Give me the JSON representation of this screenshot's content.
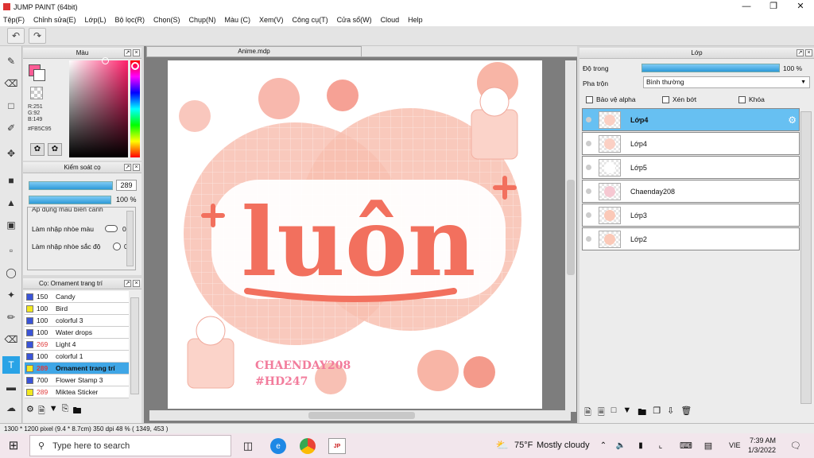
{
  "window": {
    "title": "JUMP PAINT (64bit)"
  },
  "menu": [
    "Tệp(F)",
    "Chỉnh sửa(E)",
    "Lớp(L)",
    "Bộ lọc(R)",
    "Chọn(S)",
    "Chụp(N)",
    "Màu (C)",
    "Xem(V)",
    "Công cụ(T)",
    "Cửa sổ(W)",
    "Cloud",
    "Help"
  ],
  "color_panel": {
    "title": "Màu",
    "main_color": "#FB5C95",
    "r": "R:251",
    "g": "G:92",
    "b": "B:149",
    "hex": "#FB5C95"
  },
  "brush_panel": {
    "title": "Kiểm soát cọ",
    "size": "289",
    "opacity": "100 %",
    "apply_label": "Áp dụng màu biên cảnh",
    "blur_color_label": "Làm nhập nhòe màu",
    "blur_color_value": "0",
    "blur_intensity_label": "Làm nhập nhòe sắc độ",
    "blur_intensity_value": "0"
  },
  "brush_style_panel": {
    "title": "Cọ: Ornament trang trí",
    "items": [
      {
        "size": "150",
        "name": "Candy",
        "color": "#3a54d8",
        "num_color": "#111"
      },
      {
        "size": "100",
        "name": "Bird",
        "color": "#f2e820",
        "num_color": "#111"
      },
      {
        "size": "100",
        "name": "colorful 3",
        "color": "#3a54d8",
        "num_color": "#111"
      },
      {
        "size": "100",
        "name": "Water drops",
        "color": "#3a54d8",
        "num_color": "#111"
      },
      {
        "size": "269",
        "name": "Light 4",
        "color": "#3a54d8",
        "num_color": "#e03a3a"
      },
      {
        "size": "100",
        "name": "colorful 1",
        "color": "#3a54d8",
        "num_color": "#111"
      },
      {
        "size": "289",
        "name": "Ornament trang trí",
        "color": "#f2e820",
        "num_color": "#e03a3a"
      },
      {
        "size": "700",
        "name": "Flower Stamp 3",
        "color": "#3a54d8",
        "num_color": "#111"
      },
      {
        "size": "289",
        "name": "Miktea Sticker",
        "color": "#f2e820",
        "num_color": "#e03a3a"
      }
    ]
  },
  "document": {
    "tab": "Anime.mdp",
    "watermark_line1": "CHAENDAY208",
    "watermark_line2": "#HD247",
    "artwork_text": "luôn"
  },
  "layer_panel": {
    "title": "Lớp",
    "opacity_label": "Độ trong",
    "opacity_value": "100 %",
    "blend_label": "Pha trộn",
    "blend_value": "Bình thường",
    "protect_alpha": "Bảo vệ alpha",
    "clipping": "Xén bớt",
    "lock": "Khóa",
    "layers": [
      {
        "name": "Lớp4",
        "selected": true
      },
      {
        "name": "Lớp4",
        "selected": false
      },
      {
        "name": "Lớp5",
        "selected": false
      },
      {
        "name": "Chaenday208",
        "selected": false
      },
      {
        "name": "Lớp3",
        "selected": false
      },
      {
        "name": "Lớp2",
        "selected": false
      }
    ]
  },
  "status": {
    "text": "1300 * 1200 pixel   (9.4 * 8.7cm)   350 dpi   48 %   ( 1349, 453 )"
  },
  "taskbar": {
    "search_placeholder": "Type here to search",
    "weather_temp": "75°F",
    "weather_desc": "Mostly cloudy",
    "lang": "VIE",
    "time": "7:39 AM",
    "date": "1/3/2022"
  }
}
